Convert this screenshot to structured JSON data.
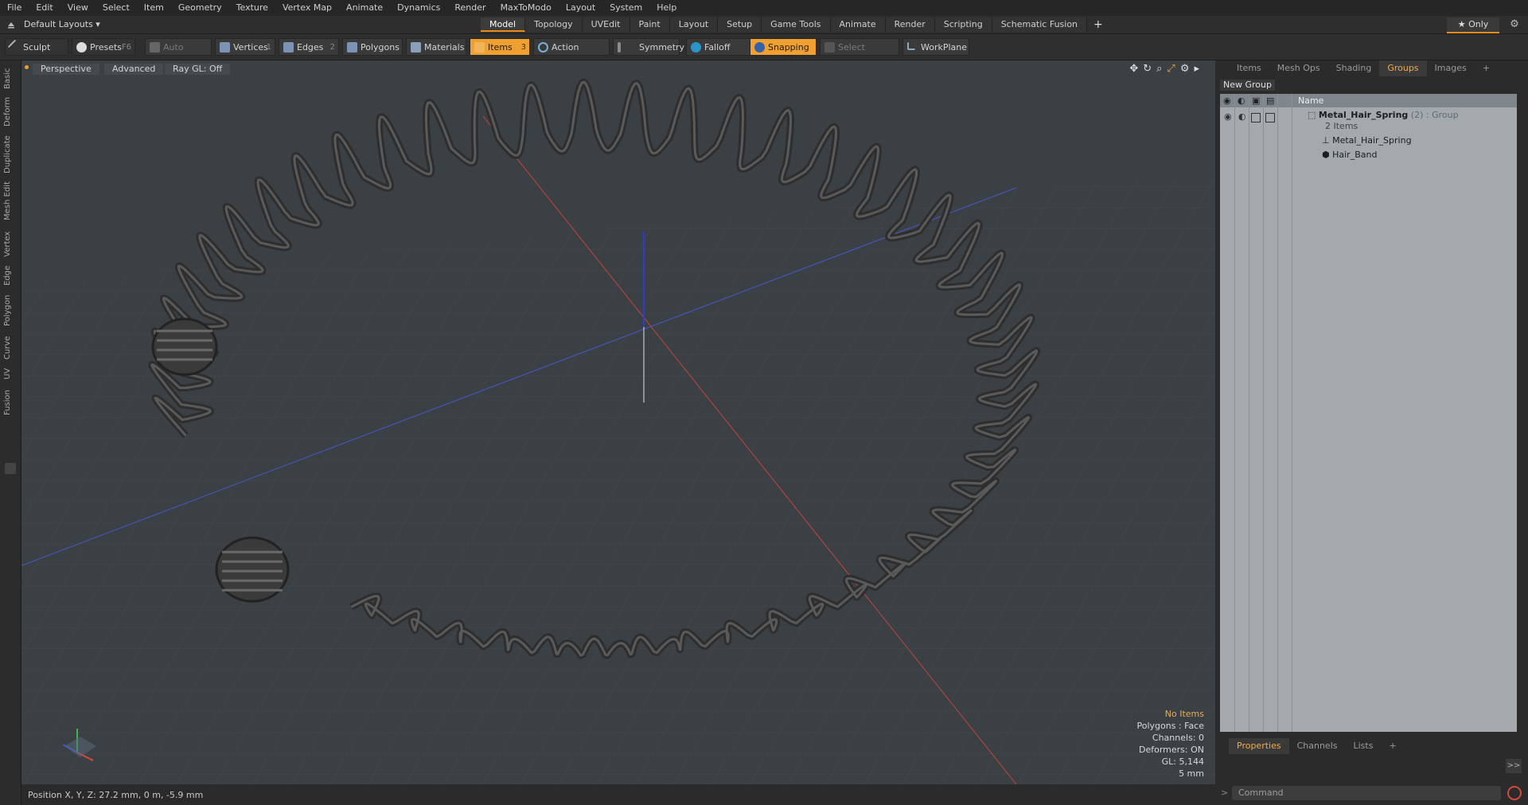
{
  "menu": [
    "File",
    "Edit",
    "View",
    "Select",
    "Item",
    "Geometry",
    "Texture",
    "Vertex Map",
    "Animate",
    "Dynamics",
    "Render",
    "MaxToModo",
    "Layout",
    "System",
    "Help"
  ],
  "layout": {
    "dropdown": "Default Layouts ▾",
    "tabs": [
      "Model",
      "Topology",
      "UVEdit",
      "Paint",
      "Layout",
      "Setup",
      "Game Tools",
      "Animate",
      "Render",
      "Scripting",
      "Schematic Fusion"
    ],
    "active_tab": "Model",
    "plus": "+",
    "only": "★ Only"
  },
  "toolbar": {
    "sculpt": "Sculpt",
    "presets": "Presets",
    "presets_key": "F6",
    "auto_select": "Auto Select",
    "vertices": "Vertices",
    "vertices_count": "1",
    "edges": "Edges",
    "edges_count": "2",
    "polygons": "Polygons",
    "materials": "Materials",
    "items": "Items",
    "items_count": "3",
    "action_center": "Action Center",
    "symmetry": "Symmetry",
    "falloff": "Falloff",
    "snapping": "Snapping",
    "select_through": "Select Through",
    "workplane": "WorkPlane"
  },
  "left_tabs": [
    "Basic",
    "Deform",
    "Duplicate",
    "Mesh Edit",
    "Vertex",
    "Edge",
    "Polygon",
    "Curve",
    "UV",
    "Fusion"
  ],
  "viewport": {
    "perspective": "Perspective",
    "advanced": "Advanced",
    "raygl": "Ray GL: Off",
    "info": {
      "no_items": "No Items",
      "polygons": "Polygons : Face",
      "channels": "Channels: 0",
      "deformers": "Deformers: ON",
      "gl": "GL: 5,144",
      "scale": "5 mm"
    }
  },
  "position_bar": "Position X, Y, Z:   27.2 mm, 0 m, -5.9 mm",
  "right_panel": {
    "tabs": [
      "Items",
      "Mesh Ops",
      "Shading",
      "Groups",
      "Images",
      "+"
    ],
    "active_tab": "Groups",
    "new_group": "New Group",
    "column_name": "Name",
    "group": {
      "name": "Metal_Hair_Spring",
      "count": "(2)",
      "type": ": Group",
      "items_label": "2 Items",
      "children": [
        "Metal_Hair_Spring",
        "Hair_Band"
      ]
    },
    "bottom_tabs": [
      "Properties",
      "Channels",
      "Lists",
      "+"
    ],
    "bottom_active": "Properties",
    "arrow": ">>",
    "command_placeholder": "Command"
  },
  "colors": {
    "accent": "#e58d1b",
    "viewport_bg": "#3b4045",
    "axis_x": "#c0463a",
    "axis_z": "#4a56c8",
    "axis_y": "#2f3bd0"
  }
}
